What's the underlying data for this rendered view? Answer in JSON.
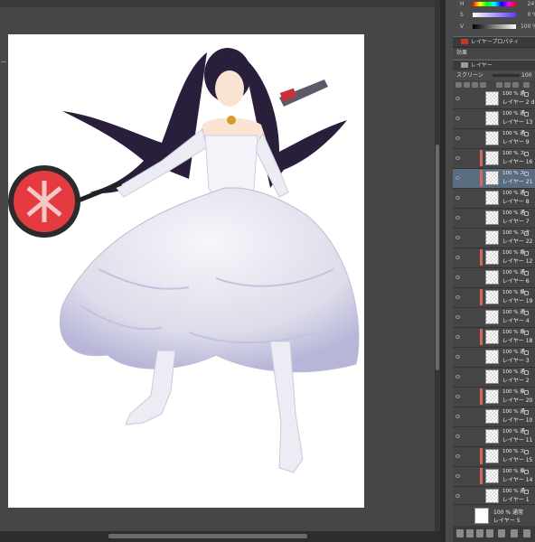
{
  "color_panel": {
    "rows": [
      {
        "letter": "H",
        "value": "247"
      },
      {
        "letter": "S",
        "value": "0 %"
      },
      {
        "letter": "V",
        "value": "100 %"
      }
    ]
  },
  "panels": {
    "layer_property_title": "レイヤープロパティ",
    "effect_label": "効果",
    "layer_panel_title": "レイヤー",
    "blend_mode": "スクリーン",
    "opacity": "100"
  },
  "layers": [
    {
      "blend": "100 % 通",
      "name": "レイヤー 2 d",
      "mark": false,
      "selected": false
    },
    {
      "blend": "100 % 通",
      "name": "レイヤー 13",
      "mark": false,
      "selected": false
    },
    {
      "blend": "100 % 通",
      "name": "レイヤー 9",
      "mark": false,
      "selected": false
    },
    {
      "blend": "100 % ス",
      "name": "レイヤー 16",
      "mark": true,
      "selected": false
    },
    {
      "blend": "100 % ス",
      "name": "レイヤー 21",
      "mark": true,
      "selected": true
    },
    {
      "blend": "100 % 通",
      "name": "レイヤー 8",
      "mark": false,
      "selected": false
    },
    {
      "blend": "100 % 通",
      "name": "レイヤー 7",
      "mark": false,
      "selected": false
    },
    {
      "blend": "100 % スク",
      "name": "レイヤー 22",
      "mark": false,
      "selected": false
    },
    {
      "blend": "100 % 乗",
      "name": "レイヤー 12",
      "mark": true,
      "selected": false
    },
    {
      "blend": "100 % 通",
      "name": "レイヤー 6",
      "mark": false,
      "selected": false
    },
    {
      "blend": "100 % 乗",
      "name": "レイヤー 19",
      "mark": true,
      "selected": false
    },
    {
      "blend": "100 % 通",
      "name": "レイヤー 4",
      "mark": false,
      "selected": false
    },
    {
      "blend": "100 % 乗",
      "name": "レイヤー 18",
      "mark": true,
      "selected": false
    },
    {
      "blend": "100 % 通",
      "name": "レイヤー 3",
      "mark": false,
      "selected": false
    },
    {
      "blend": "100 % 通",
      "name": "レイヤー 2",
      "mark": false,
      "selected": false
    },
    {
      "blend": "100 % 乗",
      "name": "レイヤー 20",
      "mark": true,
      "selected": false
    },
    {
      "blend": "100 % 通",
      "name": "レイヤー 10",
      "mark": false,
      "selected": false
    },
    {
      "blend": "100 % 通",
      "name": "レイヤー 11",
      "mark": false,
      "selected": false
    },
    {
      "blend": "100 % ス",
      "name": "レイヤー 15",
      "mark": true,
      "selected": false
    },
    {
      "blend": "100 % 乗",
      "name": "レイヤー 14",
      "mark": true,
      "selected": false
    },
    {
      "blend": "100 % 通",
      "name": "レイヤー 1",
      "mark": false,
      "selected": false
    }
  ],
  "paper_layer": {
    "blend": "100 % 通常",
    "name": "レイヤー 5"
  },
  "colors": {
    "mark": "#d46a5f",
    "selected": "#5a6d80"
  }
}
